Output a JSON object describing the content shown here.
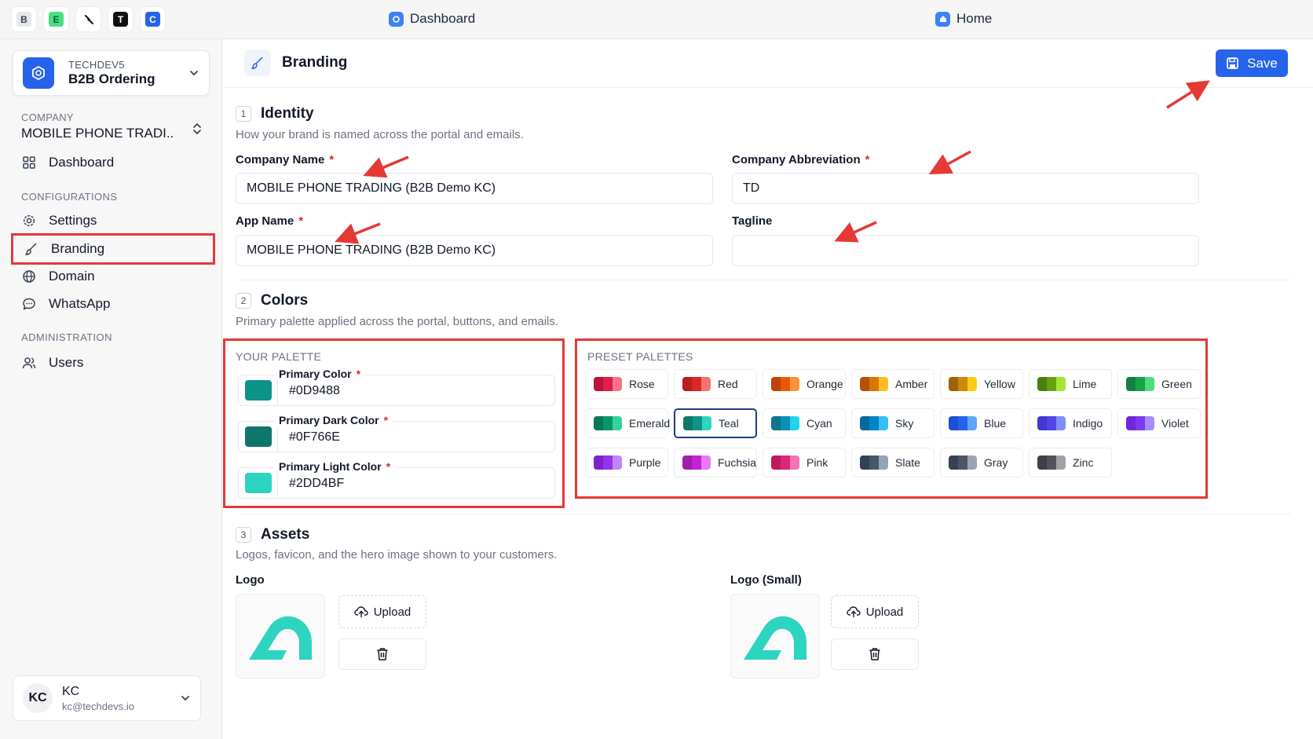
{
  "topbar": {
    "extensions": [
      {
        "letter": "B",
        "name": "b"
      },
      {
        "letter": "E",
        "name": "e"
      },
      {
        "letter": "",
        "name": "link"
      },
      {
        "letter": "T",
        "name": "t"
      },
      {
        "letter": "C",
        "name": "c"
      }
    ],
    "dashboard_link": "Dashboard",
    "home_link": "Home"
  },
  "sidebar": {
    "org_sub": "TECHDEV5",
    "org_name": "B2B Ordering",
    "company_label": "COMPANY",
    "company_name": "MOBILE PHONE TRADI..",
    "dashboard": "Dashboard",
    "configurations_label": "CONFIGURATIONS",
    "settings": "Settings",
    "branding": "Branding",
    "domain": "Domain",
    "whatsapp": "WhatsApp",
    "administration_label": "ADMINISTRATION",
    "users": "Users",
    "user_initials": "KC",
    "user_name": "KC",
    "user_email": "kc@techdevs.io"
  },
  "header": {
    "title": "Branding",
    "save_label": "Save"
  },
  "identity": {
    "num": "1",
    "title": "Identity",
    "desc": "How your brand is named across the portal and emails.",
    "company_name_label": "Company Name",
    "company_name_value": "MOBILE PHONE TRADING (B2B Demo KC)",
    "company_abbr_label": "Company Abbreviation",
    "company_abbr_value": "TD",
    "app_name_label": "App Name",
    "app_name_value": "MOBILE PHONE TRADING (B2B Demo KC)",
    "tagline_label": "Tagline",
    "tagline_value": "",
    "required_mark": "*"
  },
  "colors": {
    "num": "2",
    "title": "Colors",
    "desc": "Primary palette applied across the portal, buttons, and emails.",
    "your_palette_label": "YOUR PALETTE",
    "primary_label": "Primary Color",
    "primary_value": "#0D9488",
    "primary_dark_label": "Primary Dark Color",
    "primary_dark_value": "#0F766E",
    "primary_light_label": "Primary Light Color",
    "primary_light_value": "#2DD4BF",
    "preset_label": "PRESET PALETTES",
    "presets": [
      {
        "name": "Rose",
        "c": [
          "#be123c",
          "#e11d48",
          "#fb7185"
        ]
      },
      {
        "name": "Red",
        "c": [
          "#b91c1c",
          "#dc2626",
          "#f87171"
        ]
      },
      {
        "name": "Orange",
        "c": [
          "#c2410c",
          "#ea580c",
          "#fb923c"
        ]
      },
      {
        "name": "Amber",
        "c": [
          "#b45309",
          "#d97706",
          "#fbbf24"
        ]
      },
      {
        "name": "Yellow",
        "c": [
          "#a16207",
          "#ca8a04",
          "#facc15"
        ]
      },
      {
        "name": "Lime",
        "c": [
          "#4d7c0f",
          "#65a30d",
          "#a3e635"
        ]
      },
      {
        "name": "Green",
        "c": [
          "#15803d",
          "#16a34a",
          "#4ade80"
        ]
      },
      {
        "name": "Emerald",
        "c": [
          "#047857",
          "#059669",
          "#34d399"
        ]
      },
      {
        "name": "Teal",
        "c": [
          "#0f766e",
          "#0d9488",
          "#2dd4bf"
        ]
      },
      {
        "name": "Cyan",
        "c": [
          "#0e7490",
          "#0891b2",
          "#22d3ee"
        ]
      },
      {
        "name": "Sky",
        "c": [
          "#0369a1",
          "#0284c7",
          "#38bdf8"
        ]
      },
      {
        "name": "Blue",
        "c": [
          "#1d4ed8",
          "#2563eb",
          "#60a5fa"
        ]
      },
      {
        "name": "Indigo",
        "c": [
          "#4338ca",
          "#4f46e5",
          "#818cf8"
        ]
      },
      {
        "name": "Violet",
        "c": [
          "#6d28d9",
          "#7c3aed",
          "#a78bfa"
        ]
      },
      {
        "name": "Purple",
        "c": [
          "#7e22ce",
          "#9333ea",
          "#c084fc"
        ]
      },
      {
        "name": "Fuchsia",
        "c": [
          "#a21caf",
          "#c026d3",
          "#e879f9"
        ]
      },
      {
        "name": "Pink",
        "c": [
          "#be185d",
          "#db2777",
          "#f472b6"
        ]
      },
      {
        "name": "Slate",
        "c": [
          "#334155",
          "#475569",
          "#94a3b8"
        ]
      },
      {
        "name": "Gray",
        "c": [
          "#374151",
          "#4b5563",
          "#9ca3af"
        ]
      },
      {
        "name": "Zinc",
        "c": [
          "#3f3f46",
          "#52525b",
          "#a1a1aa"
        ]
      }
    ],
    "selected_preset": "Teal"
  },
  "assets": {
    "num": "3",
    "title": "Assets",
    "desc": "Logos, favicon, and the hero image shown to your customers.",
    "logo_label": "Logo",
    "logo_small_label": "Logo (Small)",
    "upload_label": "Upload"
  },
  "theme": {
    "accent": "#2563eb",
    "annotation": "#e53935",
    "brand_teal": "#2dd4bf"
  }
}
